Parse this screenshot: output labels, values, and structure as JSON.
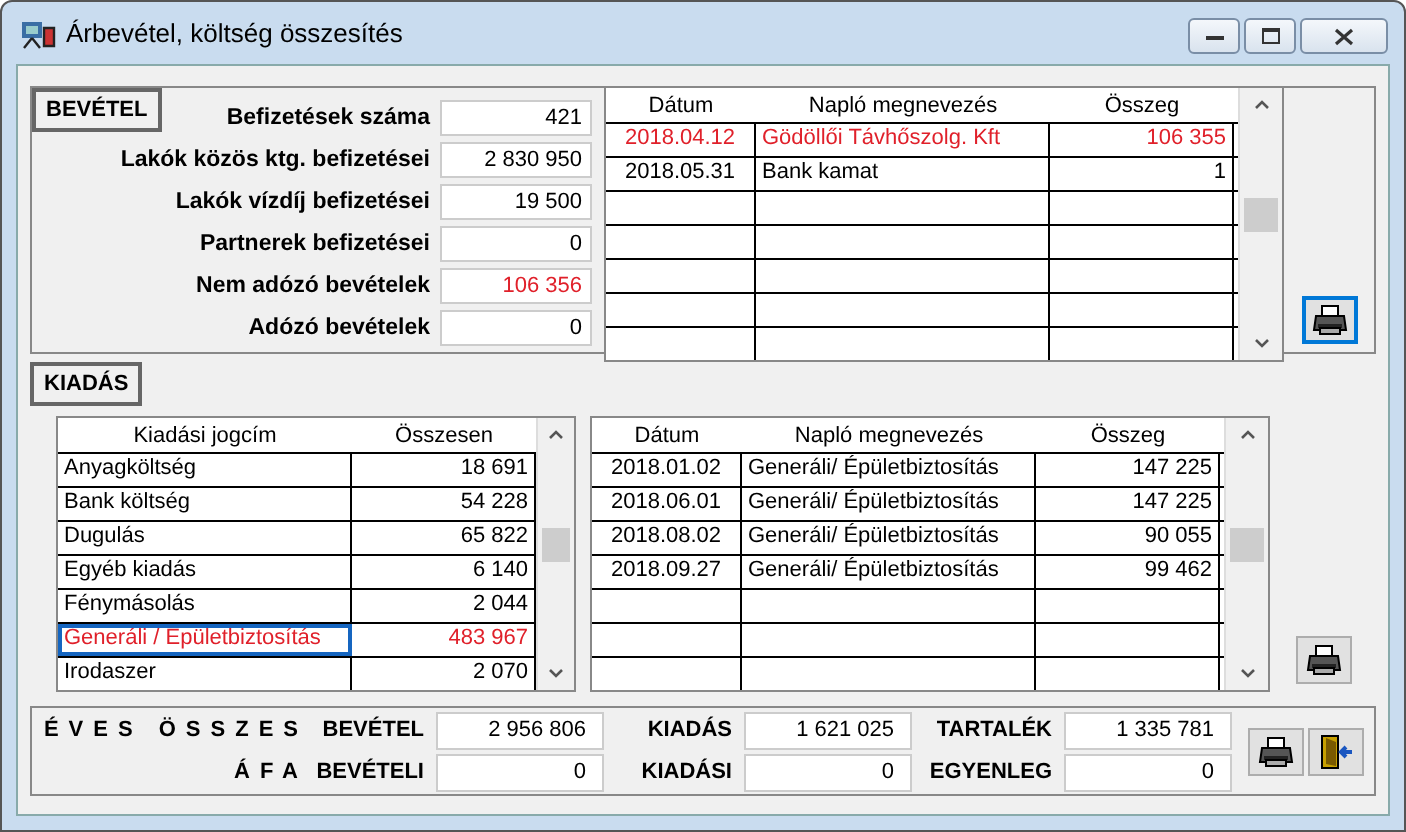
{
  "window": {
    "title": "Árbevétel, költség összesítés"
  },
  "income": {
    "label": "BEVÉTEL",
    "fields": [
      {
        "label": "Befizetések száma",
        "value": "421",
        "highlighted": false
      },
      {
        "label": "Lakók közös ktg. befizetései",
        "value": "2 830 950",
        "highlighted": false
      },
      {
        "label": "Lakók vízdíj befizetései",
        "value": "19 500",
        "highlighted": false
      },
      {
        "label": "Partnerek befizetései",
        "value": "0",
        "highlighted": false
      },
      {
        "label": "Nem adózó bevételek",
        "value": "106 356",
        "highlighted": true
      },
      {
        "label": "Adózó bevételek",
        "value": "0",
        "highlighted": false
      }
    ],
    "table": {
      "columns": [
        "Dátum",
        "Napló megnevezés",
        "Összeg"
      ],
      "rows": [
        {
          "cells": [
            "2018.04.12",
            "Gödöllői Távhőszolg. Kft",
            "106 355"
          ],
          "highlighted": true
        },
        {
          "cells": [
            "2018.05.31",
            "Bank kamat",
            "1"
          ],
          "highlighted": false
        }
      ]
    }
  },
  "expenses": {
    "label": "KIADÁS",
    "categories": {
      "columns": [
        "Kiadási jogcím",
        "Összesen"
      ],
      "rows": [
        {
          "cells": [
            "Anyagköltség",
            "18 691"
          ],
          "highlighted": false,
          "selected": false
        },
        {
          "cells": [
            "Bank költség",
            "54 228"
          ],
          "highlighted": false,
          "selected": false
        },
        {
          "cells": [
            "Dugulás",
            "65 822"
          ],
          "highlighted": false,
          "selected": false
        },
        {
          "cells": [
            "Egyéb kiadás",
            "6 140"
          ],
          "highlighted": false,
          "selected": false
        },
        {
          "cells": [
            "Fénymásolás",
            "2 044"
          ],
          "highlighted": false,
          "selected": false
        },
        {
          "cells": [
            "Generáli / Épületbiztosítás",
            "483 967"
          ],
          "highlighted": true,
          "selected": true
        },
        {
          "cells": [
            "Irodaszer",
            "2 070"
          ],
          "highlighted": false,
          "selected": false
        }
      ]
    },
    "table": {
      "columns": [
        "Dátum",
        "Napló megnevezés",
        "Összeg"
      ],
      "rows": [
        {
          "cells": [
            "2018.01.02",
            "Generáli/ Épületbiztosítás",
            "147 225"
          ],
          "highlighted": false
        },
        {
          "cells": [
            "2018.06.01",
            "Generáli/ Épületbiztosítás",
            "147 225"
          ],
          "highlighted": false
        },
        {
          "cells": [
            "2018.08.02",
            "Generáli/ Épületbiztosítás",
            "90 055"
          ],
          "highlighted": false
        },
        {
          "cells": [
            "2018.09.27",
            "Generáli/ Épületbiztosítás",
            "99 462"
          ],
          "highlighted": false
        }
      ]
    }
  },
  "summary": {
    "rows": [
      {
        "title": "ÉVES ÖSSZES",
        "items": [
          {
            "label": "BEVÉTEL",
            "value": "2 956 806"
          },
          {
            "label": "KIADÁS",
            "value": "1 621 025"
          },
          {
            "label": "TARTALÉK",
            "value": "1 335 781"
          }
        ]
      },
      {
        "title": "ÁFA",
        "items": [
          {
            "label": "BEVÉTELI",
            "value": "0"
          },
          {
            "label": "KIADÁSI",
            "value": "0"
          },
          {
            "label": "EGYENLEG",
            "value": "0"
          }
        ]
      }
    ]
  }
}
